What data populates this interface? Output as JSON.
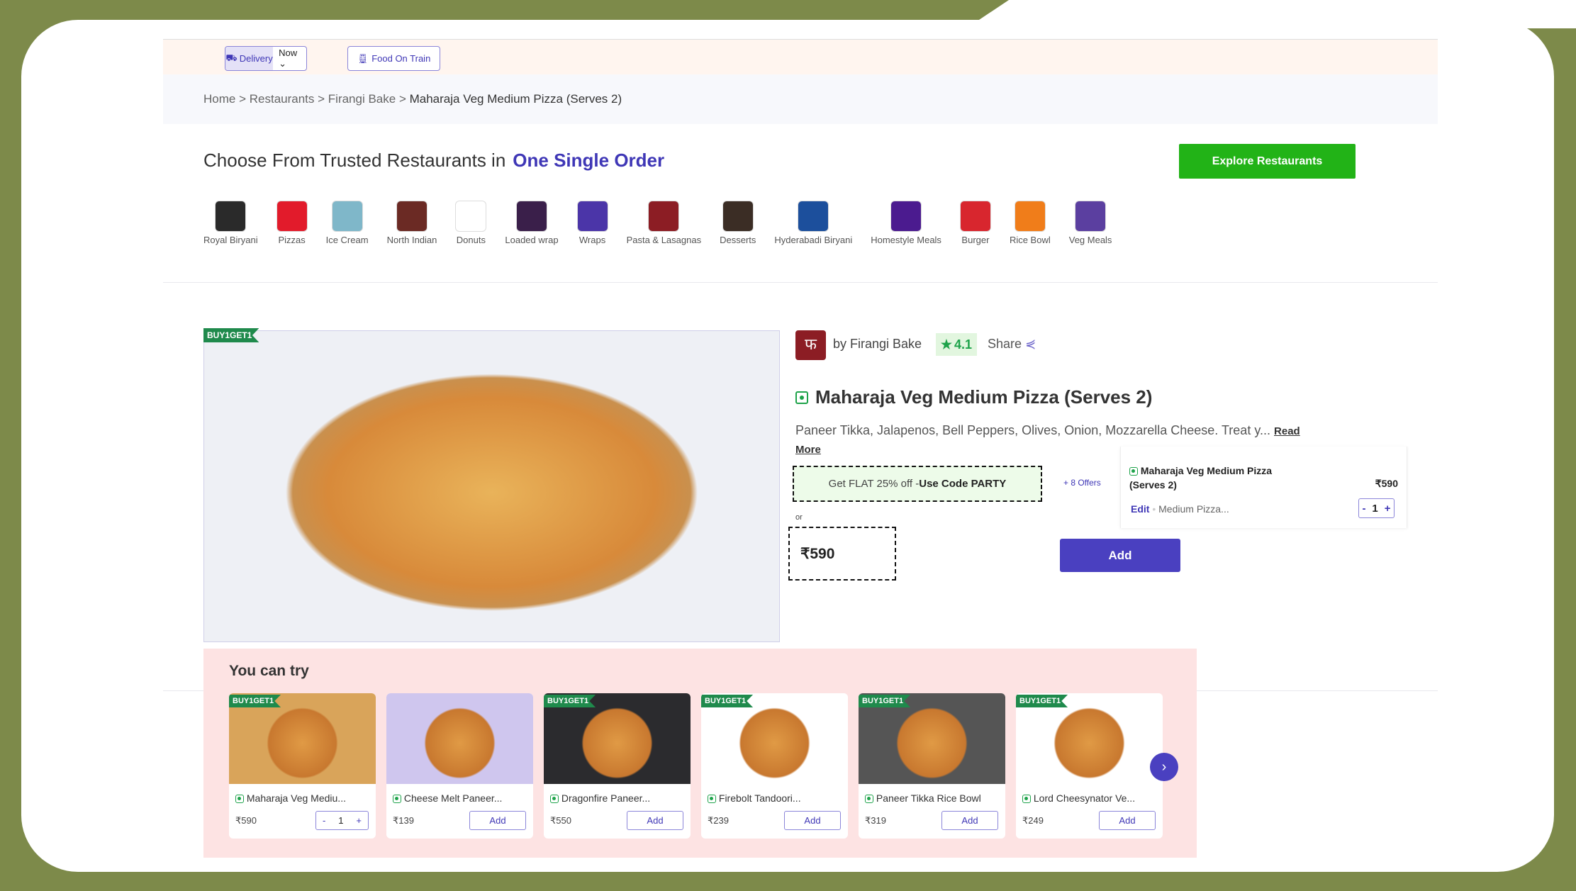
{
  "topbar": {
    "delivery": "Delivery",
    "time": "Now",
    "train": "Food On Train"
  },
  "breadcrumb": [
    "Home",
    "Restaurants",
    "Firangi Bake",
    "Maharaja Veg Medium Pizza (Serves 2)"
  ],
  "heading": {
    "text": "Choose From Trusted Restaurants in",
    "highlight": "One Single Order",
    "explore": "Explore Restaurants"
  },
  "categories": [
    {
      "label": "Royal Biryani",
      "color": "#2a2a2a"
    },
    {
      "label": "Pizzas",
      "color": "#e21b2b"
    },
    {
      "label": "Ice Cream",
      "color": "#7fb7c9"
    },
    {
      "label": "North Indian",
      "color": "#6b2a24"
    },
    {
      "label": "Donuts",
      "color": "#ffffff"
    },
    {
      "label": "Loaded wrap",
      "color": "#3a1f4a"
    },
    {
      "label": "Wraps",
      "color": "#4b35a8"
    },
    {
      "label": "Pasta & Lasagnas",
      "color": "#8c1d24"
    },
    {
      "label": "Desserts",
      "color": "#3b2d25"
    },
    {
      "label": "Hyderabadi Biryani",
      "color": "#1c4f9c"
    },
    {
      "label": "Homestyle Meals",
      "color": "#4b1b8f"
    },
    {
      "label": "Burger",
      "color": "#d8262e"
    },
    {
      "label": "Rice Bowl",
      "color": "#f07d1a"
    },
    {
      "label": "Veg Meals",
      "color": "#5b3fa0"
    }
  ],
  "product": {
    "tag": "BUY1GET1",
    "by": "by Firangi Bake",
    "rating": "4.1",
    "share": "Share",
    "title": "Maharaja Veg Medium Pizza (Serves 2)",
    "description": "Paneer Tikka, Jalapenos, Bell Peppers, Olives, Onion, Mozzarella Cheese. Treat y...",
    "read_more_1": "Read",
    "read_more_2": "More",
    "offer_text": "Get FLAT 25% off - ",
    "offer_code": "Use Code PARTY",
    "more_offers": "+ 8 Offers",
    "or": "or",
    "price": "₹590",
    "add": "Add"
  },
  "cart": {
    "name": "Maharaja Veg Medium Pizza (Serves 2)",
    "price": "₹590",
    "edit": "Edit",
    "variant": "Medium Pizza...",
    "qty": "1",
    "minus": "-",
    "plus": "+"
  },
  "try": {
    "title": "You can try",
    "items": [
      {
        "name": "Maharaja Veg Mediu...",
        "price": "₹590",
        "tag": "BUY1GET1",
        "qty": "1",
        "img": "#d9a45a"
      },
      {
        "name": "Cheese Melt Paneer...",
        "price": "₹139",
        "tag": "",
        "action": "Add",
        "img": "#cfc6ee"
      },
      {
        "name": "Dragonfire Paneer...",
        "price": "₹550",
        "tag": "BUY1GET1",
        "action": "Add",
        "img": "#2b2b2e"
      },
      {
        "name": "Firebolt Tandoori...",
        "price": "₹239",
        "tag": "BUY1GET1",
        "action": "Add",
        "img": "#ffffff"
      },
      {
        "name": "Paneer Tikka Rice Bowl",
        "price": "₹319",
        "tag": "BUY1GET1",
        "action": "Add",
        "img": "#555555"
      },
      {
        "name": "Lord Cheesynator Ve...",
        "price": "₹249",
        "tag": "BUY1GET1",
        "action": "Add",
        "img": "#ffffff"
      }
    ]
  }
}
